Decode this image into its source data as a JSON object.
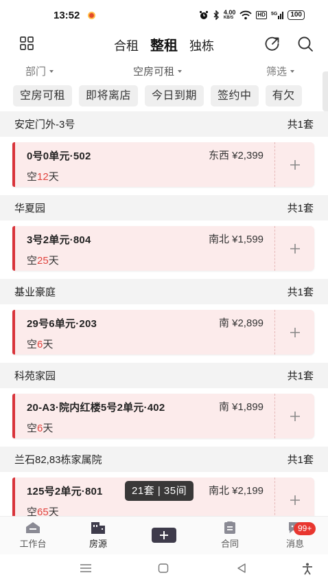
{
  "status_bar": {
    "time": "13:52",
    "network_speed_top": "4.00",
    "network_speed_unit": "KB/S",
    "hd_label": "HD",
    "signal_label": "5G",
    "battery": "100"
  },
  "header": {
    "tabs": [
      {
        "label": "合租",
        "active": false
      },
      {
        "label": "整租",
        "active": true
      },
      {
        "label": "独栋",
        "active": false
      }
    ]
  },
  "filters": {
    "department": "部门",
    "status": "空房可租",
    "screen": "筛选"
  },
  "chips": [
    "空房可租",
    "即将离店",
    "今日到期",
    "签约中",
    "有欠"
  ],
  "groups": [
    {
      "name": "安定门外-3号",
      "count": "共1套",
      "unit": "0号0单元·502",
      "orientation": "东西 ¥2,399",
      "vacant_prefix": "空",
      "vacant_days": "12",
      "vacant_suffix": "天"
    },
    {
      "name": "华夏园",
      "count": "共1套",
      "unit": "3号2单元·804",
      "orientation": "南北 ¥1,599",
      "vacant_prefix": "空",
      "vacant_days": "25",
      "vacant_suffix": "天"
    },
    {
      "name": "基业豪庭",
      "count": "共1套",
      "unit": "29号6单元·203",
      "orientation": "南 ¥2,899",
      "vacant_prefix": "空",
      "vacant_days": "6",
      "vacant_suffix": "天"
    },
    {
      "name": "科苑家园",
      "count": "共1套",
      "unit": "20-A3·院内红楼5号2单元·402",
      "orientation": "南 ¥1,899",
      "vacant_prefix": "空",
      "vacant_days": "6",
      "vacant_suffix": "天"
    },
    {
      "name": "兰石82,83栋家属院",
      "count": "共1套",
      "unit": "125号2单元·801",
      "orientation": "南北 ¥2,199",
      "vacant_prefix": "空",
      "vacant_days": "65",
      "vacant_suffix": "天"
    }
  ],
  "toast": "21套 | 35间",
  "bottom_nav": {
    "workbench": "工作台",
    "listings": "房源",
    "contracts": "合同",
    "messages": "消息",
    "messages_badge": "99+"
  },
  "colors": {
    "accent_red": "#d9333a",
    "card_bg": "#fcebeb",
    "days_red": "#e0443e",
    "nav_dark": "#3e3b4b"
  }
}
